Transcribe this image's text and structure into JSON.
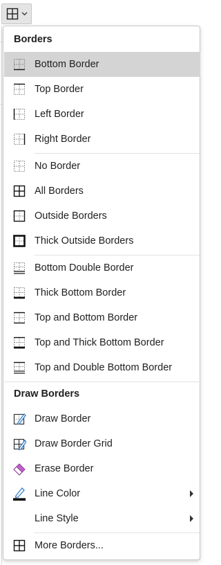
{
  "toolbar": {
    "button_icon": "all-borders-icon",
    "dropdown_icon": "chevron-down-icon"
  },
  "menu": {
    "borders_header": "Borders",
    "borders_items": [
      {
        "label": "Bottom Border",
        "icon": "bottom-border-icon",
        "highlighted": true
      },
      {
        "label": "Top Border",
        "icon": "top-border-icon"
      },
      {
        "label": "Left Border",
        "icon": "left-border-icon"
      },
      {
        "label": "Right Border",
        "icon": "right-border-icon"
      },
      {
        "label": "No Border",
        "icon": "no-border-icon"
      },
      {
        "label": "All Borders",
        "icon": "all-borders-icon"
      },
      {
        "label": "Outside Borders",
        "icon": "outside-borders-icon"
      },
      {
        "label": "Thick Outside Borders",
        "icon": "thick-outside-borders-icon"
      },
      {
        "label": "Bottom Double Border",
        "icon": "bottom-double-border-icon"
      },
      {
        "label": "Thick Bottom Border",
        "icon": "thick-bottom-border-icon"
      },
      {
        "label": "Top and Bottom Border",
        "icon": "top-and-bottom-border-icon"
      },
      {
        "label": "Top and Thick Bottom Border",
        "icon": "top-and-thick-bottom-border-icon"
      },
      {
        "label": "Top and Double Bottom Border",
        "icon": "top-and-double-bottom-border-icon"
      }
    ],
    "draw_header": "Draw Borders",
    "draw_items": [
      {
        "label": "Draw Border",
        "icon": "draw-border-icon"
      },
      {
        "label": "Draw Border Grid",
        "icon": "draw-border-grid-icon"
      },
      {
        "label": "Erase Border",
        "icon": "eraser-icon"
      },
      {
        "label": "Line Color",
        "icon": "line-color-icon",
        "submenu": true
      },
      {
        "label": "Line Style",
        "icon": "",
        "submenu": true
      },
      {
        "label": "More Borders...",
        "icon": "more-borders-icon"
      }
    ],
    "colors": {
      "highlight": "#d4d4d4",
      "icon_blue": "#3a7fc4",
      "eraser_pink": "#c061c9",
      "line_color_bar": "#000000"
    }
  }
}
